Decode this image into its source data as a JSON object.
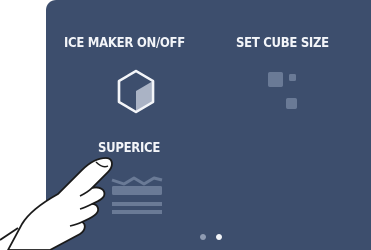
{
  "menu": {
    "items": [
      {
        "label": "ICE MAKER ON/OFF",
        "icon": "ice-cube-icon"
      },
      {
        "label": "SET CUBE SIZE",
        "icon": "cube-size-icon"
      },
      {
        "label": "SUPERICE",
        "icon": "superice-icon"
      }
    ]
  },
  "pager": {
    "pages": 2,
    "current": 2
  },
  "colors": {
    "panel": "#3d4e6d",
    "text": "#f3f5f9",
    "icon_muted": "#6a7a96"
  }
}
